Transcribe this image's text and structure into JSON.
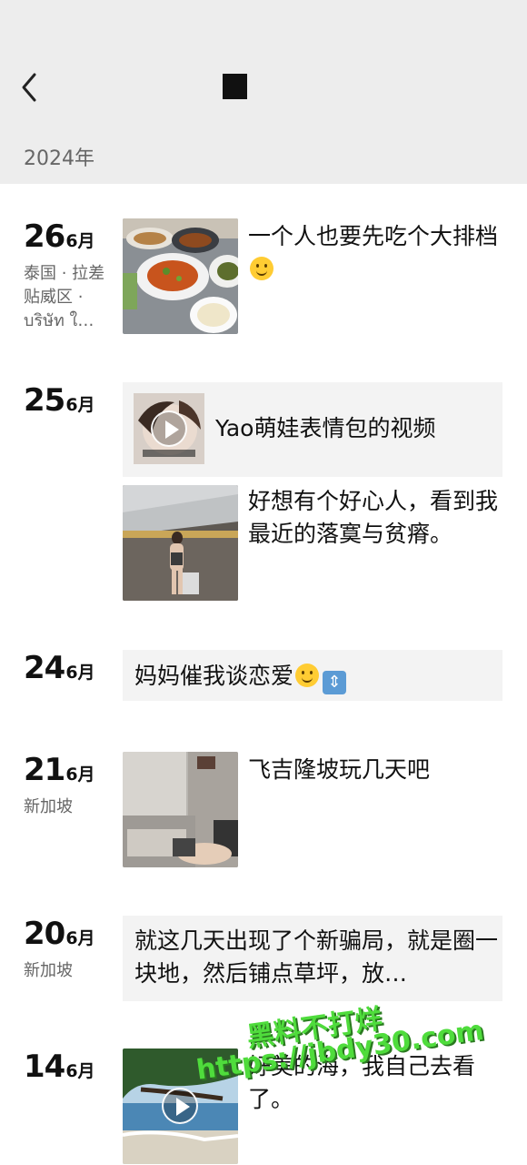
{
  "header": {
    "year": "2024年"
  },
  "entries": [
    {
      "day": "26",
      "month": "6月",
      "location": "泰国 · 拉差贴威区 · บริษัท ใ…",
      "text": "一个人也要先吃个大排档",
      "emoji": "yum-emoji"
    },
    {
      "day": "25",
      "month": "6月",
      "video_text": "Yao萌娃表情包的视频",
      "text": "好想有个好心人，看到我最近的落寞与贫瘠。"
    },
    {
      "day": "24",
      "month": "6月",
      "text": "妈妈催我谈恋爱",
      "emoji": "smile-emoji",
      "emoji2": "up-down-arrow-emoji"
    },
    {
      "day": "21",
      "month": "6月",
      "location": "新加坡",
      "text": "飞吉隆坡玩几天吧"
    },
    {
      "day": "20",
      "month": "6月",
      "location": "新加坡",
      "text": "就这几天出现了个新骗局，就是圈一块地，然后铺点草坪，放…"
    },
    {
      "day": "14",
      "month": "6月",
      "text": "好美的海，我自己去看了。"
    }
  ],
  "watermark": {
    "line1": "黑料不打烊",
    "line2": "https://jbdy30.com"
  },
  "colors": {
    "header_bg": "#ededed",
    "card_bg": "#f3f3f3",
    "watermark": "#4fdc3c"
  }
}
